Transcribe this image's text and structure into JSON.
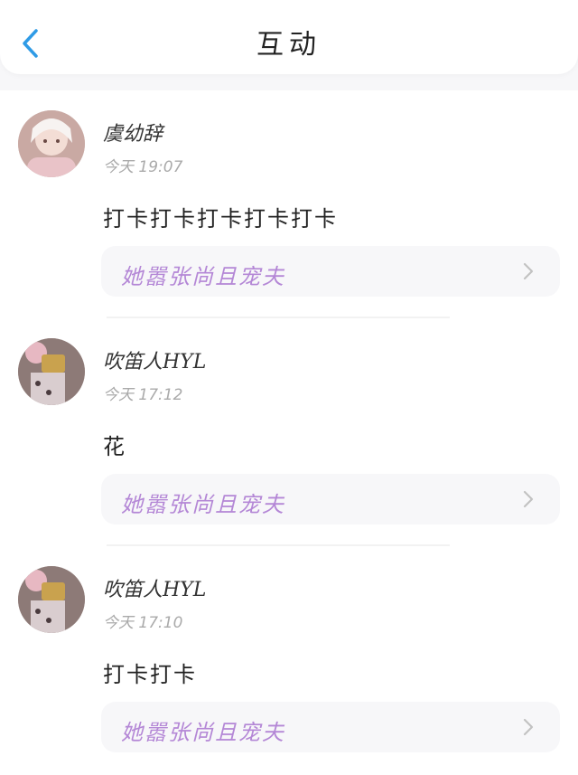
{
  "header": {
    "title": "互动",
    "back_icon": "chevron-left-icon",
    "accent_color": "#2f9be6"
  },
  "link_color": "#b487d6",
  "posts": [
    {
      "username": "虞幼辞",
      "time": "今天 19:07",
      "content": "打卡打卡打卡打卡打卡",
      "link": "她嚣张尚且宠夫"
    },
    {
      "username": "吹笛人HYL",
      "time": "今天 17:12",
      "content": "花",
      "link": "她嚣张尚且宠夫"
    },
    {
      "username": "吹笛人HYL",
      "time": "今天 17:10",
      "content": "打卡打卡",
      "link": "她嚣张尚且宠夫"
    }
  ]
}
